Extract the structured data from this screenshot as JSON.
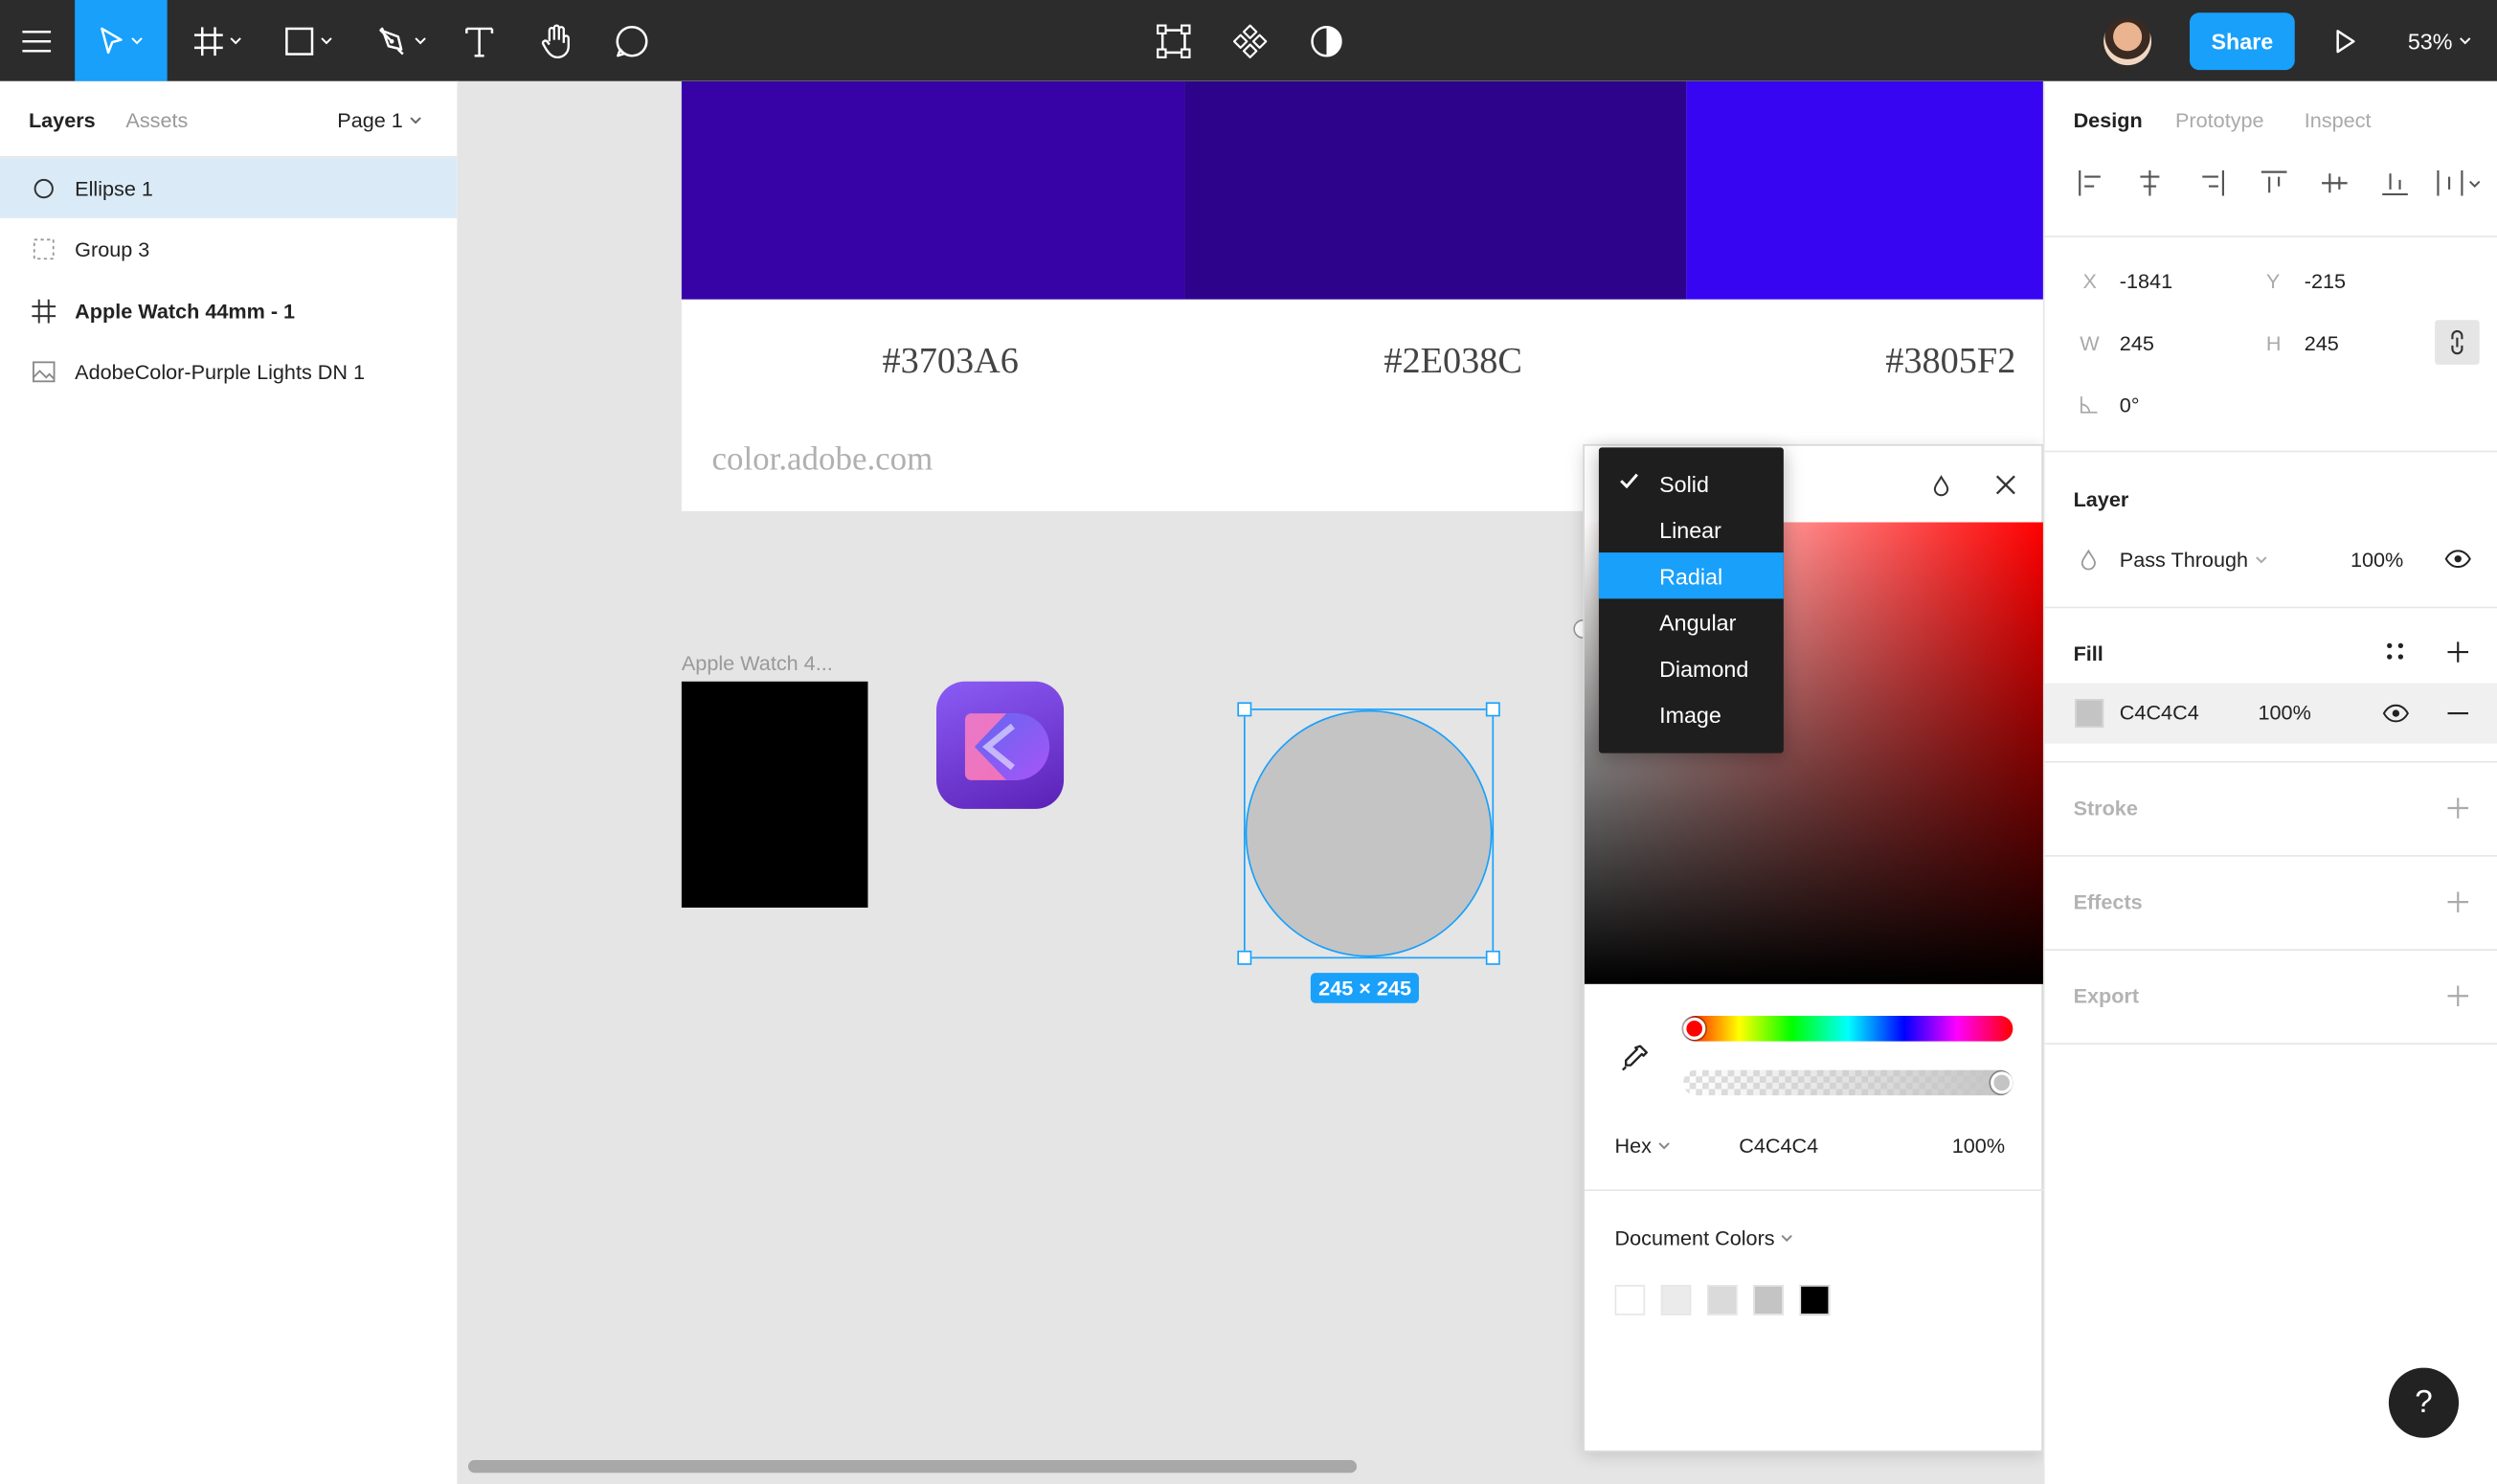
{
  "toolbar": {
    "share_label": "Share",
    "zoom_label": "53%",
    "tools": [
      "menu-icon",
      "move-tool-icon",
      "frame-tool-icon",
      "shape-tool-icon",
      "pen-tool-icon",
      "text-tool-icon",
      "hand-tool-icon",
      "comment-tool-icon"
    ],
    "center_tools": [
      "component-instance-icon",
      "component-icon",
      "mask-icon"
    ]
  },
  "left_panel": {
    "tab_layers": "Layers",
    "tab_assets": "Assets",
    "page_label": "Page 1",
    "layers": [
      {
        "name": "Ellipse 1",
        "icon": "ellipse-icon",
        "selected": true,
        "bold": false
      },
      {
        "name": "Group 3",
        "icon": "group-icon",
        "selected": false,
        "bold": false
      },
      {
        "name": "Apple Watch 44mm - 1",
        "icon": "frame-icon",
        "selected": false,
        "bold": true
      },
      {
        "name": "AdobeColor-Purple Lights DN 1",
        "icon": "image-icon",
        "selected": false,
        "bold": false
      }
    ]
  },
  "canvas": {
    "swatches": [
      {
        "hex": "#3703A6",
        "color": "#3703A6"
      },
      {
        "hex": "#2E038C",
        "color": "#2E038C"
      },
      {
        "hex": "#3805F2",
        "color": "#3805F2"
      }
    ],
    "adobe_url": "color.adobe.com",
    "frame_label": "Apple Watch 4...",
    "size_badge": "245 × 245",
    "ellipse_color": "#C4C4C4",
    "selection_color": "#18A0FB"
  },
  "picker": {
    "fill_types": [
      "Solid",
      "Linear",
      "Radial",
      "Angular",
      "Diamond",
      "Image"
    ],
    "checked_type": "Solid",
    "highlighted_type": "Radial",
    "format_label": "Hex",
    "hex_value": "C4C4C4",
    "opacity_value": "100%",
    "document_colors_label": "Document Colors",
    "document_colors": [
      "#FFFFFF",
      "#EBEBEB",
      "#DADADA",
      "#C4C4C4",
      "#000000"
    ]
  },
  "right_panel": {
    "tab_design": "Design",
    "tab_prototype": "Prototype",
    "tab_inspect": "Inspect",
    "x_label": "X",
    "x_value": "-1841",
    "y_label": "Y",
    "y_value": "-215",
    "w_label": "W",
    "w_value": "245",
    "h_label": "H",
    "h_value": "245",
    "rotation_value": "0°",
    "layer_title": "Layer",
    "blend_mode": "Pass Through",
    "layer_opacity": "100%",
    "fill_title": "Fill",
    "fill_hex": "C4C4C4",
    "fill_opacity": "100%",
    "stroke_title": "Stroke",
    "effects_title": "Effects",
    "export_title": "Export",
    "help_label": "?"
  }
}
